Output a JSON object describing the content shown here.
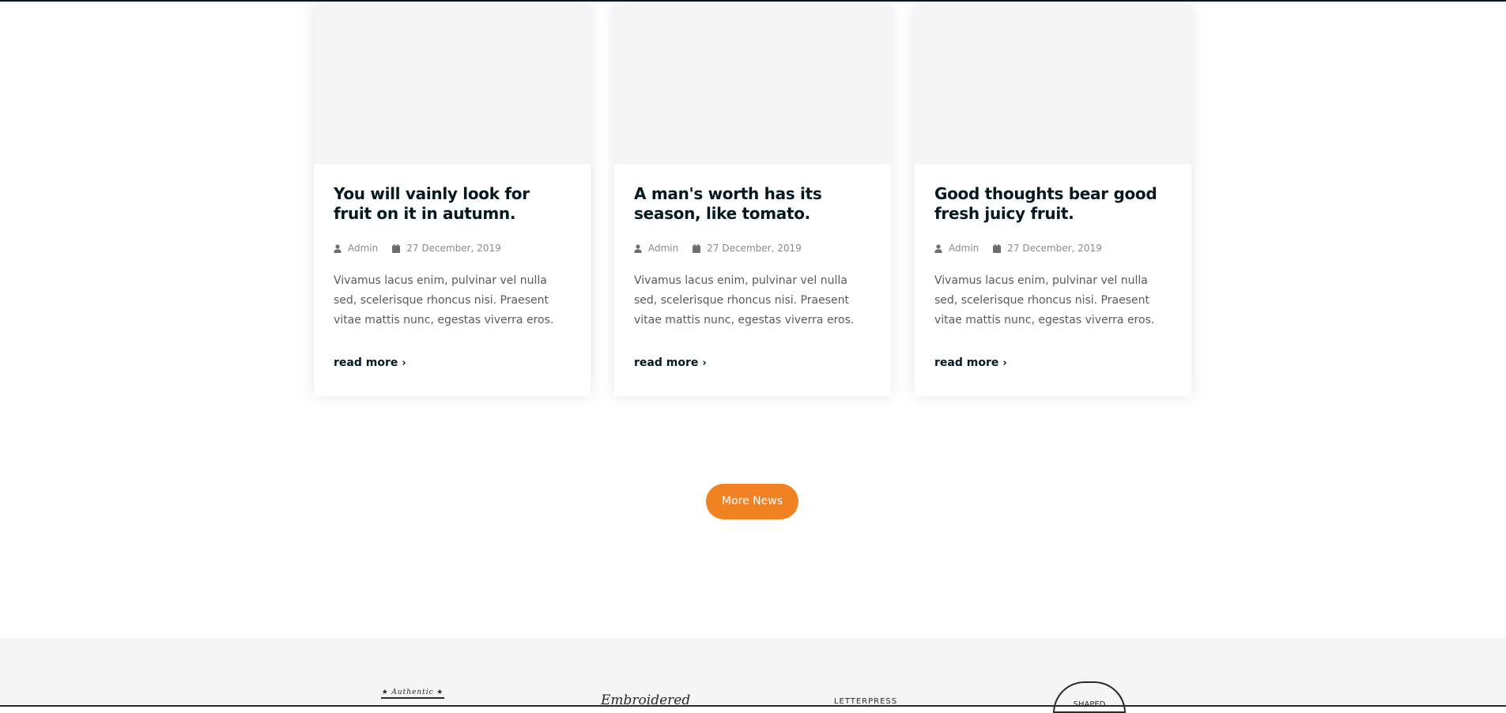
{
  "cards": [
    {
      "title": "You will vainly look for fruit on it in autumn.",
      "author": "Admin",
      "date": "27 December, 2019",
      "excerpt": "Vivamus lacus enim, pulvinar vel nulla sed, scelerisque rhoncus nisi. Praesent vitae mattis nunc, egestas viverra eros.",
      "read_more": "read more"
    },
    {
      "title": "A man's worth has its season, like tomato.",
      "author": "Admin",
      "date": "27 December, 2019",
      "excerpt": "Vivamus lacus enim, pulvinar vel nulla sed, scelerisque rhoncus nisi. Praesent vitae mattis nunc, egestas viverra eros.",
      "read_more": "read more"
    },
    {
      "title": "Good thoughts bear good fresh juicy fruit.",
      "author": "Admin",
      "date": "27 December, 2019",
      "excerpt": "Vivamus lacus enim, pulvinar vel nulla sed, scelerisque rhoncus nisi. Praesent vitae mattis nunc, egestas viverra eros.",
      "read_more": "read more"
    }
  ],
  "more_news_label": "More News",
  "icons": {
    "author": "user-icon",
    "date": "calendar-icon",
    "read_more": "chevron-right-icon"
  },
  "colors": {
    "accent": "#F28123",
    "heading": "#051922",
    "image_placeholder": "#f5f5f5",
    "logos_band": "#f5f5f5"
  },
  "brand_logos": [
    {
      "name": "authentic-brand-logo",
      "text": "Authentic"
    },
    {
      "name": "embroidered-brand-logo",
      "text": "Embroidered"
    },
    {
      "name": "letterpress-brand-logo",
      "text": "LETTERPRESS"
    },
    {
      "name": "badge-brand-logo",
      "text": "SHAPED"
    }
  ]
}
